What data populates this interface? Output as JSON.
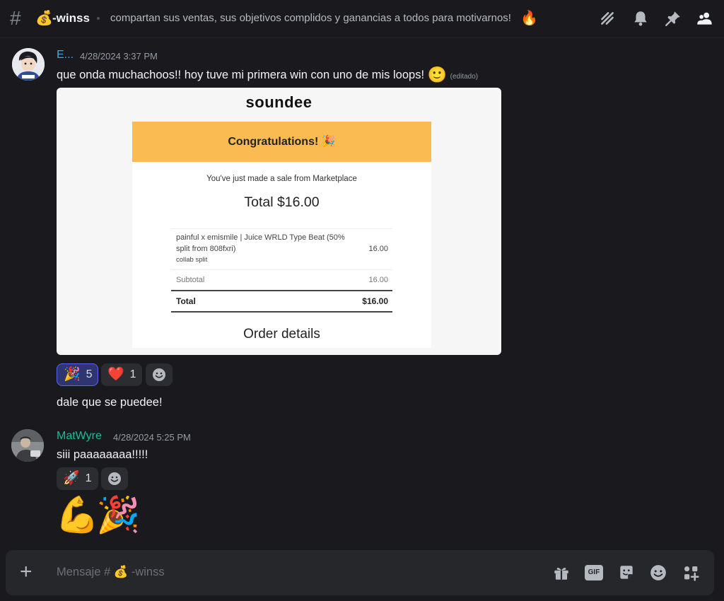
{
  "header": {
    "hash_symbol": "#",
    "channel_emoji": "💰",
    "channel_name": "-winss",
    "topic_text": "compartan sus ventas, sus objetivos complidos y ganancias a todos para motivarnos!",
    "topic_emoji": "🔥",
    "icons": [
      "threads-icon",
      "bell-icon",
      "pin-icon",
      "members-icon"
    ]
  },
  "messages": [
    {
      "author": "E...",
      "author_color": "#3ba5e6",
      "timestamp": "4/28/2024 3:37 PM",
      "lines": [
        {
          "text": "que onda muchachoos!! hoy tuve mi primera win con uno de mis loops!",
          "emoji": "🙂",
          "edited": "(editado)"
        }
      ],
      "attachment": {
        "brand": "soundee",
        "banner_text": "Congratulations!",
        "banner_emoji": "🎉",
        "sale_text": "You've just made a sale from Marketplace",
        "total_big": "Total $16.00",
        "item_line1": "painful x emismile | Juice WRLD Type Beat (50%",
        "item_line2": "split from 808fxri)",
        "item_note": "collab split",
        "item_amount": "16.00",
        "subtotal_label": "Subtotal",
        "subtotal_value": "16.00",
        "total_label": "Total",
        "total_value": "$16.00",
        "order_details": "Order details"
      },
      "reactions": [
        {
          "emoji": "🎉",
          "count": "5",
          "active": true
        },
        {
          "emoji": "❤️",
          "count": "1",
          "active": false
        }
      ],
      "followup": "dale que se puedee!"
    },
    {
      "author": "MatWyre",
      "author_color": "#1abc9c",
      "timestamp": "4/28/2024 5:25 PM",
      "text": "siii paaaaaaaa!!!!!",
      "reactions": [
        {
          "emoji": "🚀",
          "count": "1",
          "active": false
        }
      ],
      "big_emojis": "💪🎉"
    }
  ],
  "composer": {
    "placeholder": "Mensaje # 💰 -winss",
    "plus": "+",
    "gif_label": "GIF",
    "icons": [
      "gift-icon",
      "gif-icon",
      "sticker-icon",
      "emoji-icon",
      "apps-icon"
    ]
  },
  "colors": {
    "background": "#1a1a1e",
    "accent": "#5865f2",
    "banner": "#fbbb53"
  }
}
